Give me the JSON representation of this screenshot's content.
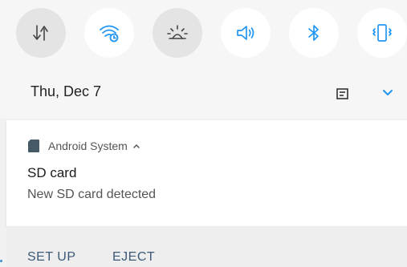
{
  "quick_settings": {
    "tiles": [
      {
        "name": "mobile-data",
        "icon": "data-arrows-icon",
        "state": "off"
      },
      {
        "name": "wifi",
        "icon": "wifi-icon",
        "state": "on"
      },
      {
        "name": "night-light",
        "icon": "sunrise-icon",
        "state": "off"
      },
      {
        "name": "sound",
        "icon": "speaker-icon",
        "state": "on"
      },
      {
        "name": "bluetooth",
        "icon": "bluetooth-icon",
        "state": "on"
      },
      {
        "name": "vibrate",
        "icon": "vibrate-icon",
        "state": "on"
      }
    ],
    "date": "Thu, Dec 7"
  },
  "notification": {
    "app_name": "Android System",
    "title": "SD card",
    "text": "New SD card detected",
    "actions": {
      "setup": "SET UP",
      "eject": "EJECT"
    }
  },
  "colors": {
    "accent": "#2196F3",
    "icon_dark": "#444444",
    "action_text": "#3c5a78"
  }
}
